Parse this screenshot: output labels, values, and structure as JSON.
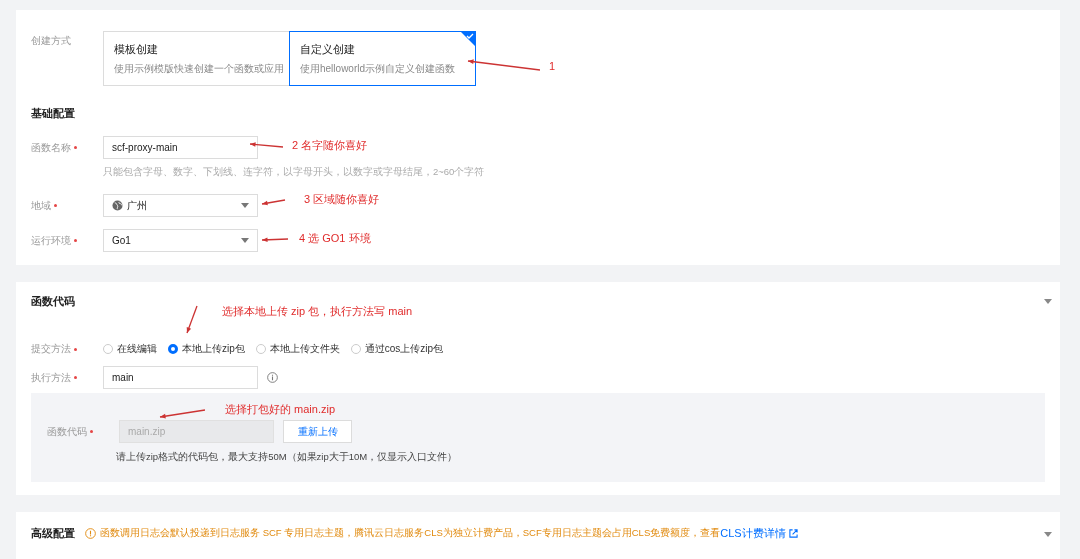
{
  "creation": {
    "label": "创建方式",
    "options": [
      {
        "title": "模板创建",
        "description": "使用示例模版快速创建一个函数或应用",
        "selected": false
      },
      {
        "title": "自定义创建",
        "description": "使用helloworld示例自定义创建函数",
        "selected": true
      }
    ]
  },
  "basic": {
    "title": "基础配置",
    "fields": [
      {
        "kind": "input",
        "label": "函数名称",
        "required": true,
        "value": "scf-proxy-main",
        "hint": "只能包含字母、数字、下划线、连字符，以字母开头，以数字或字母结尾，2~60个字符"
      },
      {
        "kind": "globe-select",
        "label": "地域",
        "required": true,
        "value": "广州"
      },
      {
        "kind": "select",
        "label": "运行环境",
        "required": true,
        "value": "Go1"
      }
    ]
  },
  "code": {
    "title": "函数代码",
    "submit": {
      "label": "提交方法",
      "required": true,
      "options": [
        {
          "label": "在线编辑",
          "selected": false
        },
        {
          "label": "本地上传zip包",
          "selected": true
        },
        {
          "label": "本地上传文件夹",
          "selected": false
        },
        {
          "label": "通过cos上传zip包",
          "selected": false
        }
      ]
    },
    "handler": {
      "label": "执行方法",
      "required": true,
      "value": "main"
    },
    "package": {
      "label": "函数代码",
      "required": true,
      "value": "main.zip",
      "disabled": true,
      "button": "重新上传",
      "hint": "请上传zip格式的代码包，最大支持50M（如果zip大于10M，仅显示入口文件）"
    }
  },
  "advanced": {
    "title": "高级配置",
    "notice": "函数调用日志会默认投递到日志服务 SCF 专用日志主题，腾讯云日志服务CLS为独立计费产品，SCF专用日志主题会占用CLS免费额度，查看",
    "link": "CLS计费详情"
  },
  "annotations": [
    {
      "text": "1"
    },
    {
      "text": "2 名字随你喜好"
    },
    {
      "text": "3 区域随你喜好"
    },
    {
      "text": "4 选 GO1 环境"
    },
    {
      "text": "选择本地上传 zip 包，执行方法写 main"
    },
    {
      "text": "选择打包好的 main.zip"
    }
  ]
}
